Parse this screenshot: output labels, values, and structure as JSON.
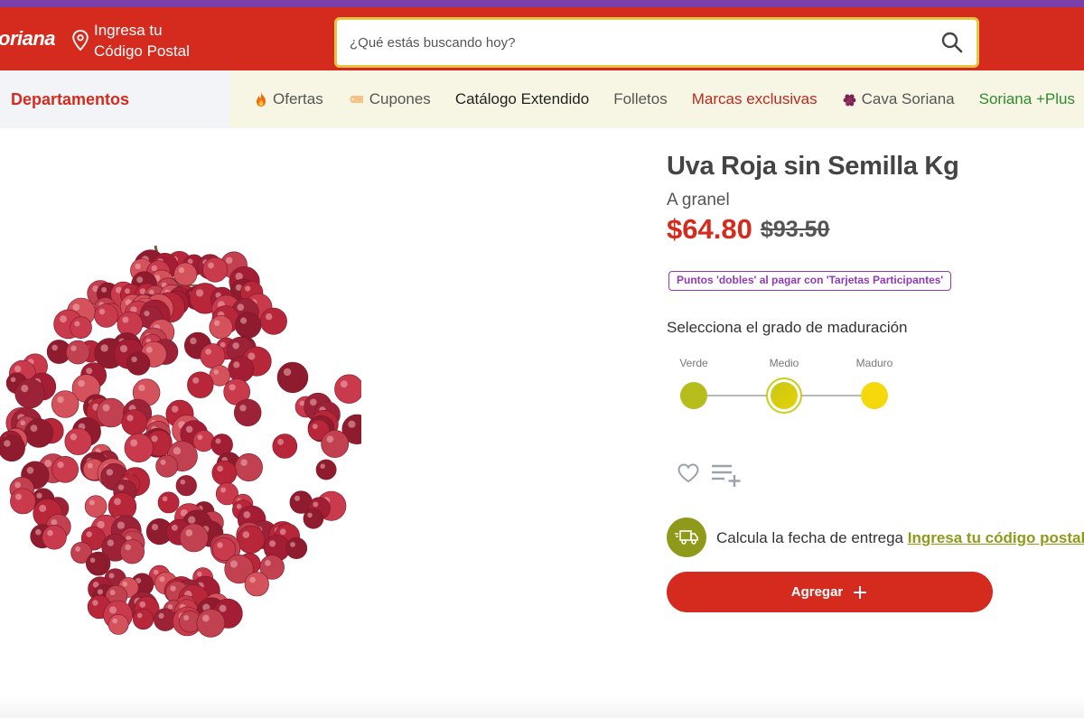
{
  "header": {
    "logo": "oriana",
    "postal_line1": "Ingresa tu",
    "postal_line2": "Código Postal",
    "search_placeholder": "¿Qué estás buscando hoy?"
  },
  "nav": {
    "departments": "Departamentos",
    "items": [
      {
        "label": "Ofertas",
        "icon": "fire-icon",
        "color": "#555555"
      },
      {
        "label": "Cupones",
        "icon": "coupon-icon",
        "color": "#555555"
      },
      {
        "label": "Catálogo Extendido",
        "icon": "",
        "color": "#222222"
      },
      {
        "label": "Folletos",
        "icon": "",
        "color": "#555555"
      },
      {
        "label": "Marcas exclusivas",
        "icon": "",
        "color": "#c0281c"
      },
      {
        "label": "Cava Soriana",
        "icon": "grapes-icon",
        "color": "#555555"
      },
      {
        "label": "Soriana +Plus",
        "icon": "",
        "color": "#2e8b2e"
      }
    ]
  },
  "product": {
    "title": "Uva Roja sin Semilla Kg",
    "subtitle": "A granel",
    "price": "$64.80",
    "old_price": "$93.50",
    "promo_badge": "Puntos 'dobles' al pagar con 'Tarjetas Participantes'",
    "image": "red-grapes-bunch"
  },
  "ripeness": {
    "title": "Selecciona el grado de maduración",
    "options": [
      "Verde",
      "Medio",
      "Maduro"
    ],
    "selected": "Medio"
  },
  "delivery": {
    "text": "Calcula la fecha de entrega",
    "link": "Ingresa tu código postal"
  },
  "actions": {
    "add_label": "Agregar"
  },
  "colors": {
    "brand_red": "#d52b1e",
    "top_strip": "#7a3fa8",
    "search_border": "#e5c544",
    "olive": "#8f9a1a",
    "badge_purple": "#8e3bb4"
  }
}
